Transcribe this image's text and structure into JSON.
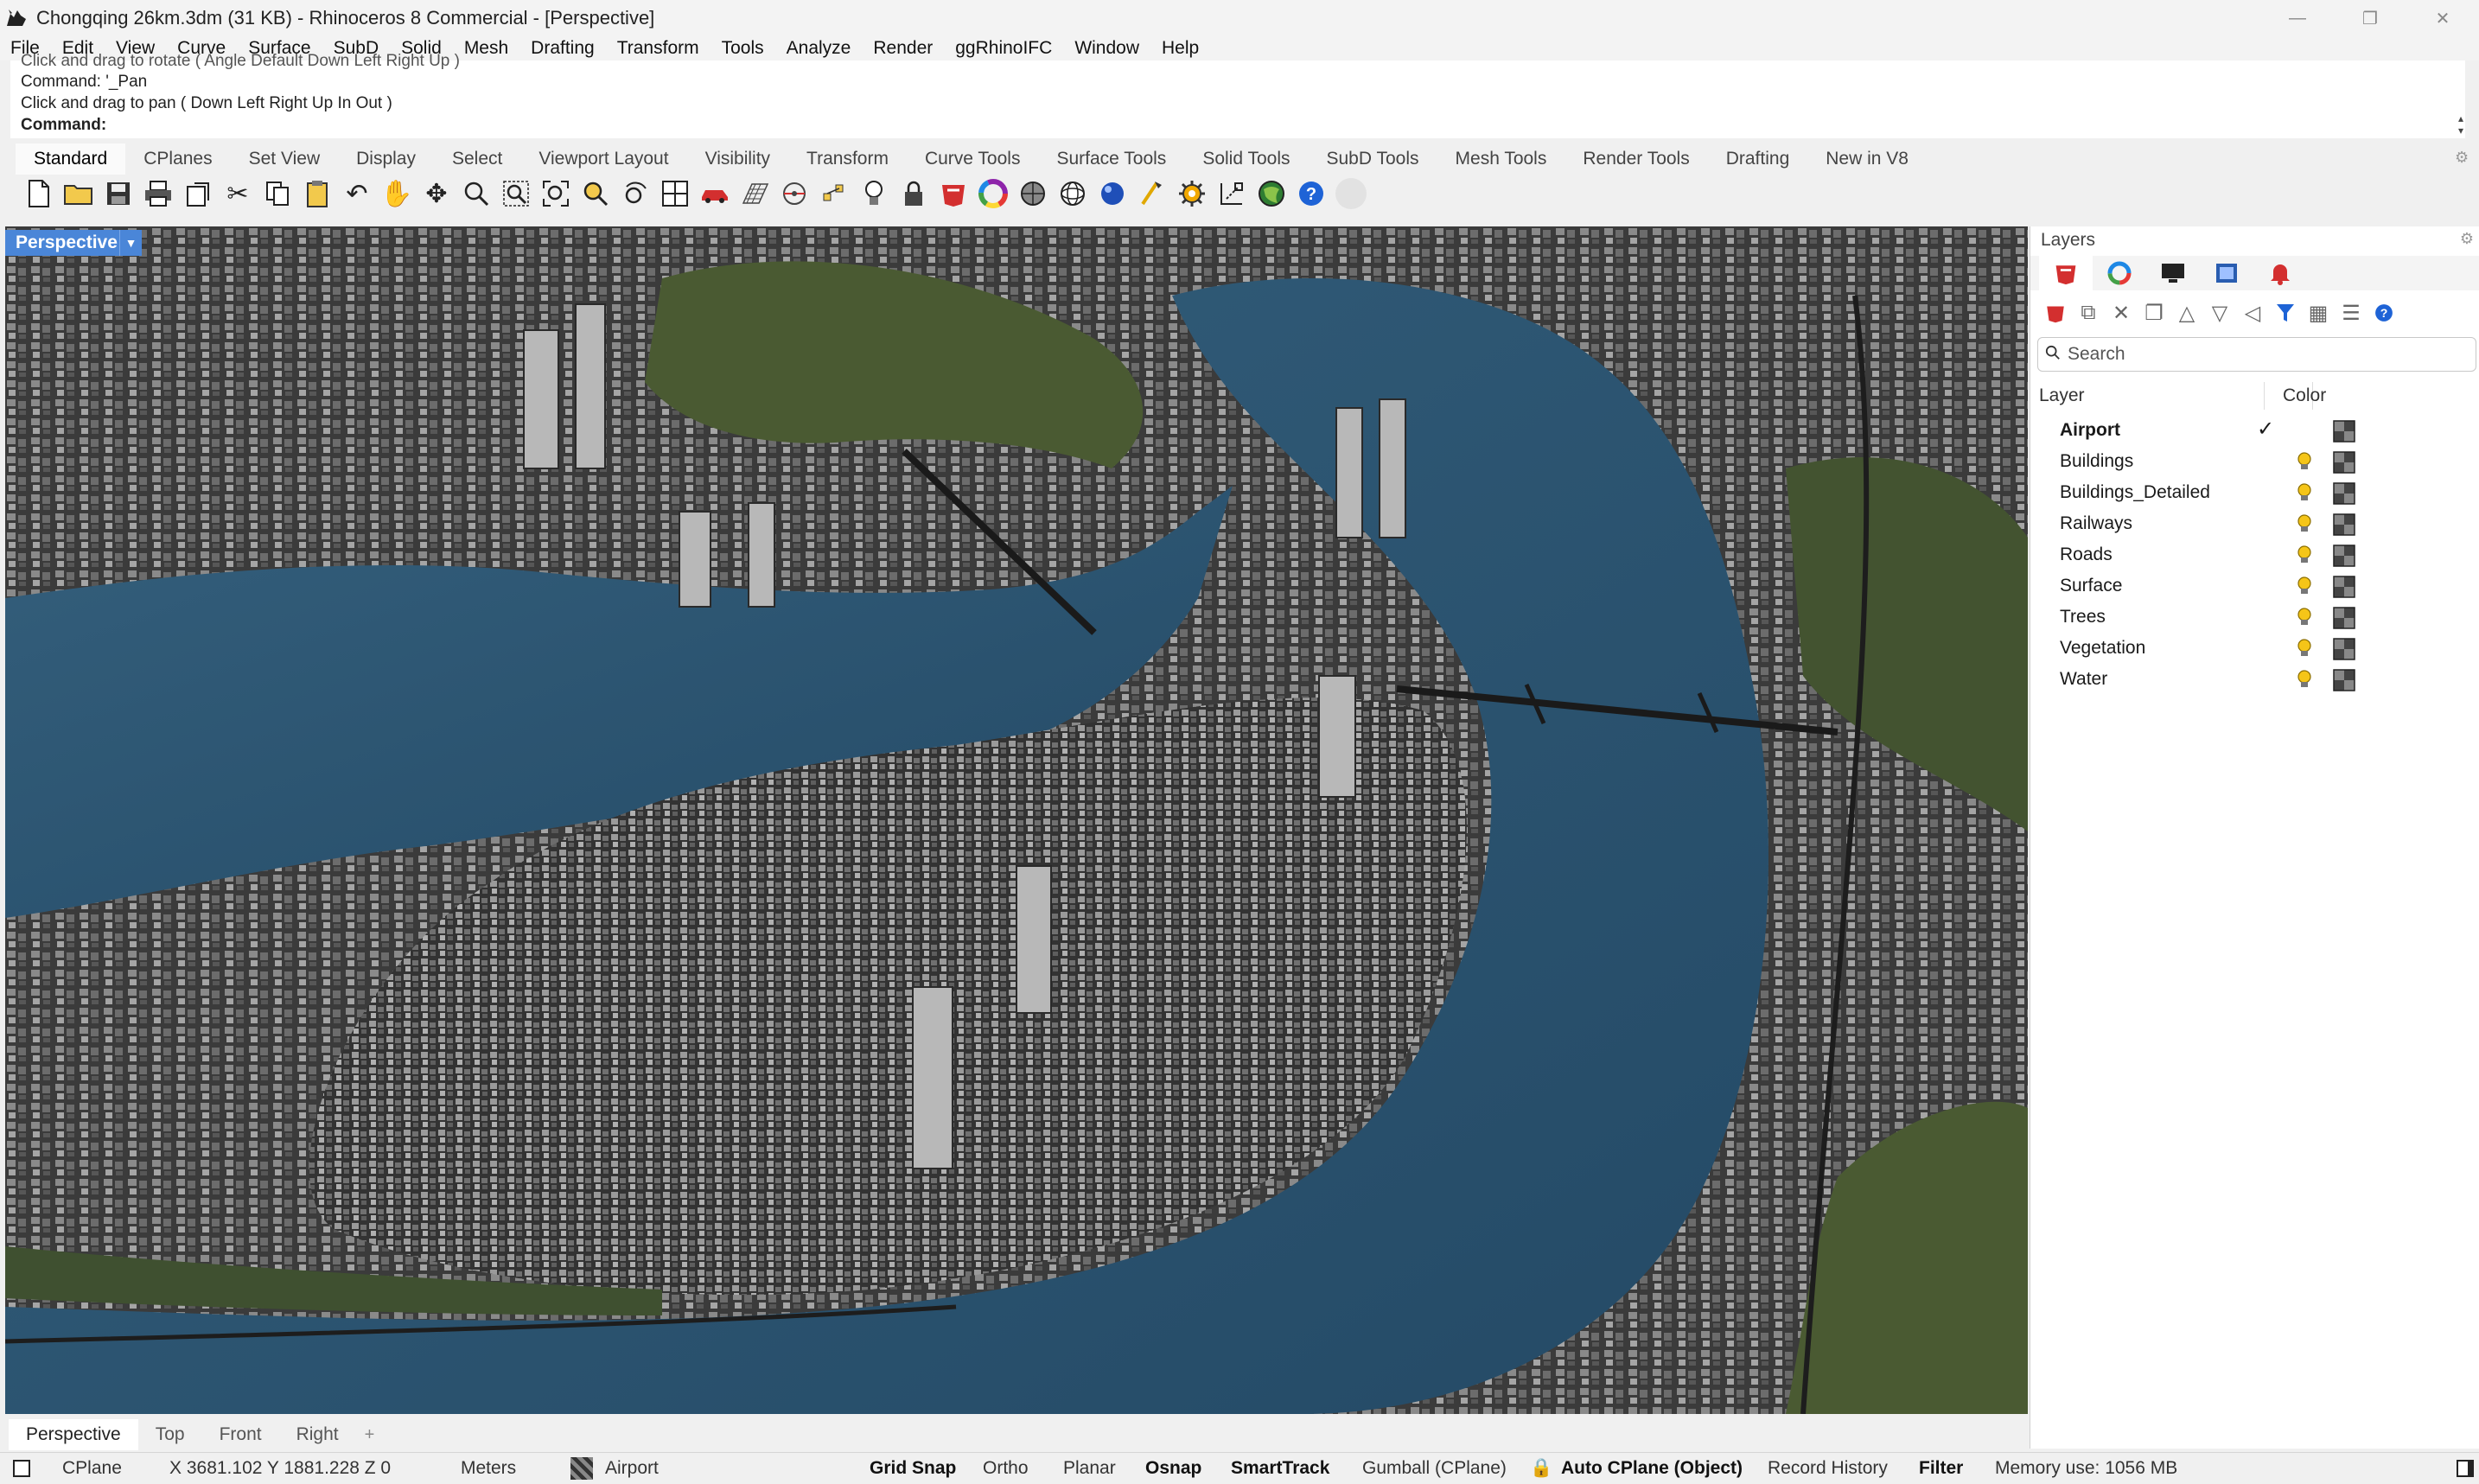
{
  "window": {
    "title": "Chongqing 26km.3dm (31 KB) - Rhinoceros 8 Commercial - [Perspective]",
    "controls": [
      "—",
      "❐",
      "✕"
    ]
  },
  "menu": [
    "File",
    "Edit",
    "View",
    "Curve",
    "Surface",
    "SubD",
    "Solid",
    "Mesh",
    "Drafting",
    "Transform",
    "Tools",
    "Analyze",
    "Render",
    "ggRhinoIFC",
    "Window",
    "Help"
  ],
  "command": {
    "history": [
      "Click and drag to rotate ( Angle  Default  Down  Left  Right  Up )",
      "Command: '_Pan",
      "Click and drag to pan ( Down  Left  Right  Up  In  Out )"
    ],
    "prompt": "Command:"
  },
  "toolbar_tabs": [
    "Standard",
    "CPlanes",
    "Set View",
    "Display",
    "Select",
    "Viewport Layout",
    "Visibility",
    "Transform",
    "Curve Tools",
    "Surface Tools",
    "Solid Tools",
    "SubD Tools",
    "Mesh Tools",
    "Render Tools",
    "Drafting",
    "New in V8"
  ],
  "toolbar_icons": [
    "new-file-icon",
    "open-folder-icon",
    "save-icon",
    "print-icon",
    "import-icon",
    "cut-icon",
    "copy-icon",
    "paste-icon",
    "undo-icon",
    "pan-hand-icon",
    "move-icon",
    "zoom-icon",
    "zoom-window-icon",
    "zoom-extents-icon",
    "zoom-selected-icon",
    "rotate-view-icon",
    "four-views-icon",
    "car-icon",
    "grid-icon",
    "cplane-icon",
    "points-icon",
    "lightbulb-icon",
    "lock-icon",
    "layer-icon",
    "color-wheel-icon",
    "shaded-sphere-icon",
    "wireframe-sphere-icon",
    "render-sphere-icon",
    "select-icon",
    "options-gear-icon",
    "dimension-icon",
    "globe-icon",
    "help-icon",
    "blank-circle-icon"
  ],
  "viewport": {
    "label": "Perspective"
  },
  "viewport_tabs": [
    "Perspective",
    "Top",
    "Front",
    "Right"
  ],
  "layers_panel": {
    "title": "Layers",
    "search_placeholder": "Search",
    "col_layer": "Layer",
    "col_color": "Color",
    "layers": [
      {
        "name": "Airport",
        "current": true
      },
      {
        "name": "Buildings",
        "current": false
      },
      {
        "name": "Buildings_Detailed",
        "current": false
      },
      {
        "name": "Railways",
        "current": false
      },
      {
        "name": "Roads",
        "current": false
      },
      {
        "name": "Surface",
        "current": false
      },
      {
        "name": "Trees",
        "current": false
      },
      {
        "name": "Vegetation",
        "current": false
      },
      {
        "name": "Water",
        "current": false
      }
    ]
  },
  "status": {
    "cplane": "CPlane",
    "coords": "X 3681.102 Y 1881.228 Z 0",
    "units": "Meters",
    "layer": "Airport",
    "grid_snap": "Grid Snap",
    "ortho": "Ortho",
    "planar": "Planar",
    "osnap": "Osnap",
    "smarttrack": "SmartTrack",
    "gumball": "Gumball (CPlane)",
    "auto_cplane": "Auto CPlane (Object)",
    "record_history": "Record History",
    "filter": "Filter",
    "memory": "Memory use: 1056 MB"
  },
  "colors": {
    "viewport_label_bg": "#4a86d8",
    "river": "#2f5a78",
    "city_dark": "#3a3a3a",
    "vegetation": "#4a5a32"
  }
}
